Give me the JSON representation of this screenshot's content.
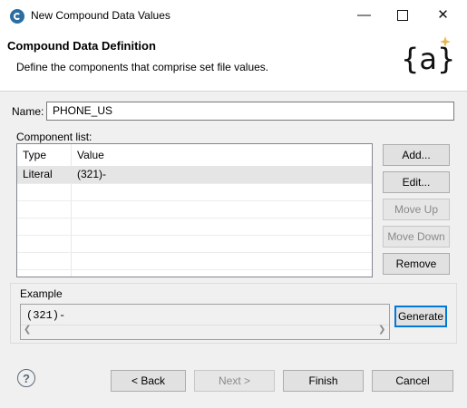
{
  "window": {
    "title": "New Compound Data Values",
    "minimize_icon": "minimize-icon",
    "maximize_icon": "maximize-icon",
    "close_icon": "close-icon"
  },
  "header": {
    "title": "Compound Data Definition",
    "description": "Define the components that comprise set file values.",
    "logo_text": "{a}"
  },
  "form": {
    "name_label": "Name:",
    "name_value": "PHONE_US",
    "component_list_label": "Component list:",
    "columns": [
      "Type",
      "Value"
    ],
    "rows": [
      {
        "type": "Literal",
        "value": "(321)-"
      }
    ]
  },
  "side_buttons": {
    "add": "Add...",
    "edit": "Edit...",
    "move_up": "Move Up",
    "move_down": "Move Down",
    "remove": "Remove"
  },
  "example": {
    "label": "Example",
    "value": "(321)-",
    "generate": "Generate"
  },
  "footer": {
    "help_icon": "help-icon",
    "help_glyph": "?",
    "back": "< Back",
    "next": "Next >",
    "finish": "Finish",
    "cancel": "Cancel"
  },
  "colors": {
    "accent": "#0078d7",
    "selection": "#e5e5e5",
    "logo_star": "#e8b84a"
  }
}
